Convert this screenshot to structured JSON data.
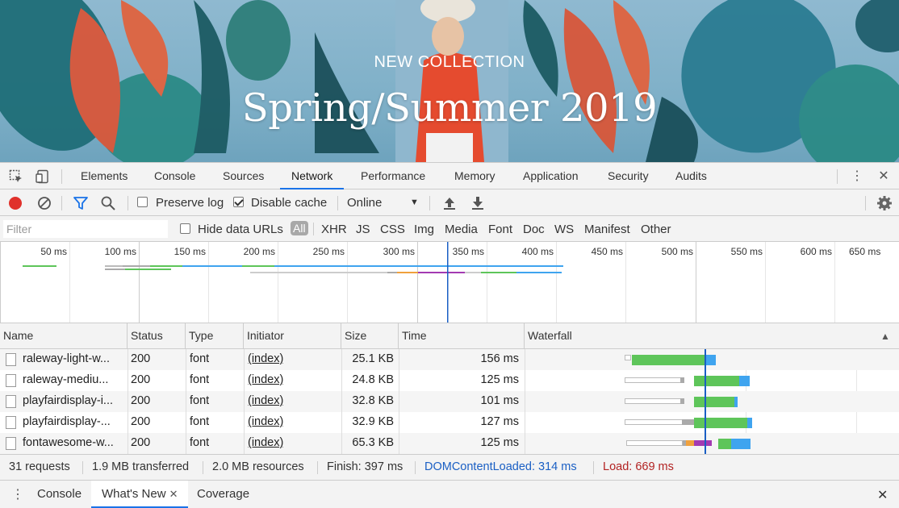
{
  "hero": {
    "eyebrow": "NEW COLLECTION",
    "headline": "Spring/Summer 2019"
  },
  "devtools": {
    "tabs": [
      "Elements",
      "Console",
      "Sources",
      "Network",
      "Performance",
      "Memory",
      "Application",
      "Security",
      "Audits"
    ],
    "active_tab": "Network"
  },
  "toolbar": {
    "preserve_log_label": "Preserve log",
    "preserve_log_checked": false,
    "disable_cache_label": "Disable cache",
    "disable_cache_checked": true,
    "throttle_value": "Online"
  },
  "filter": {
    "placeholder": "Filter",
    "hide_data_urls_label": "Hide data URLs",
    "types": [
      "All",
      "XHR",
      "JS",
      "CSS",
      "Img",
      "Media",
      "Font",
      "Doc",
      "WS",
      "Manifest",
      "Other"
    ],
    "active_type": "All"
  },
  "overview": {
    "ticks": [
      "50 ms",
      "100 ms",
      "150 ms",
      "200 ms",
      "250 ms",
      "300 ms",
      "350 ms",
      "400 ms",
      "450 ms",
      "500 ms",
      "550 ms",
      "600 ms",
      "650 ms"
    ]
  },
  "table": {
    "columns": [
      "Name",
      "Status",
      "Type",
      "Initiator",
      "Size",
      "Time",
      "Waterfall"
    ],
    "rows": [
      {
        "name": "raleway-light-w...",
        "status": "200",
        "type": "font",
        "initiator": "(index)",
        "size": "25.1 KB",
        "time": "156 ms"
      },
      {
        "name": "raleway-mediu...",
        "status": "200",
        "type": "font",
        "initiator": "(index)",
        "size": "24.8 KB",
        "time": "125 ms"
      },
      {
        "name": "playfairdisplay-i...",
        "status": "200",
        "type": "font",
        "initiator": "(index)",
        "size": "32.8 KB",
        "time": "101 ms"
      },
      {
        "name": "playfairdisplay-...",
        "status": "200",
        "type": "font",
        "initiator": "(index)",
        "size": "32.9 KB",
        "time": "127 ms"
      },
      {
        "name": "fontawesome-w...",
        "status": "200",
        "type": "font",
        "initiator": "(index)",
        "size": "65.3 KB",
        "time": "125 ms"
      }
    ]
  },
  "summary": {
    "requests": "31 requests",
    "transferred": "1.9 MB transferred",
    "resources": "2.0 MB resources",
    "finish": "Finish: 397 ms",
    "dom_content_loaded": "DOMContentLoaded: 314 ms",
    "load": "Load: 669 ms"
  },
  "drawer": {
    "tabs": [
      "Console",
      "What's New",
      "Coverage"
    ],
    "active_tab": "What's New"
  },
  "colors": {
    "accent": "#1a73e8",
    "record": "#e0312b",
    "waiting": "#5ec55a",
    "download": "#3fa4ef",
    "dcl": "#1a5fc4",
    "load": "#b22222"
  }
}
